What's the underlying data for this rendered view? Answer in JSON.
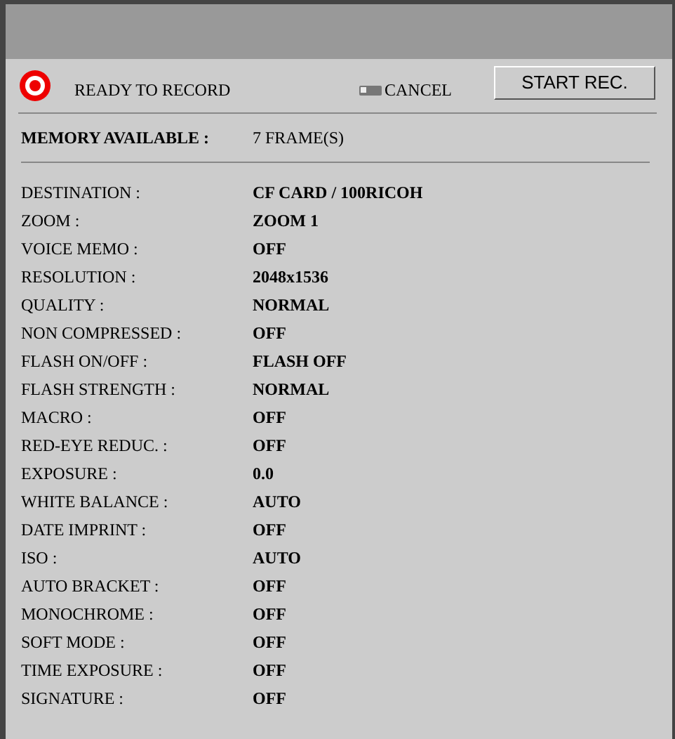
{
  "header": {
    "status": "READY TO RECORD",
    "cancel": "CANCEL",
    "start_button": "START REC."
  },
  "memory": {
    "label": "MEMORY AVAILABLE :",
    "value": "7 FRAME(S)"
  },
  "settings": [
    {
      "label": "DESTINATION :",
      "value": "CF CARD / 100RICOH"
    },
    {
      "label": "ZOOM :",
      "value": "ZOOM 1"
    },
    {
      "label": "VOICE MEMO :",
      "value": "OFF"
    },
    {
      "label": "RESOLUTION :",
      "value": "2048x1536"
    },
    {
      "label": "QUALITY :",
      "value": "NORMAL"
    },
    {
      "label": "NON COMPRESSED :",
      "value": "OFF"
    },
    {
      "label": "FLASH ON/OFF :",
      "value": "FLASH OFF"
    },
    {
      "label": "FLASH STRENGTH :",
      "value": "NORMAL"
    },
    {
      "label": "MACRO :",
      "value": "OFF"
    },
    {
      "label": "RED-EYE REDUC. :",
      "value": "OFF"
    },
    {
      "label": "EXPOSURE :",
      "value": "0.0"
    },
    {
      "label": "WHITE BALANCE :",
      "value": "AUTO"
    },
    {
      "label": "DATE IMPRINT :",
      "value": "OFF"
    },
    {
      "label": "ISO :",
      "value": "AUTO"
    },
    {
      "label": "AUTO BRACKET :",
      "value": "OFF"
    },
    {
      "label": "MONOCHROME :",
      "value": "OFF"
    },
    {
      "label": "SOFT MODE :",
      "value": "OFF"
    },
    {
      "label": "TIME EXPOSURE :",
      "value": "OFF"
    },
    {
      "label": "SIGNATURE :",
      "value": "OFF"
    }
  ]
}
